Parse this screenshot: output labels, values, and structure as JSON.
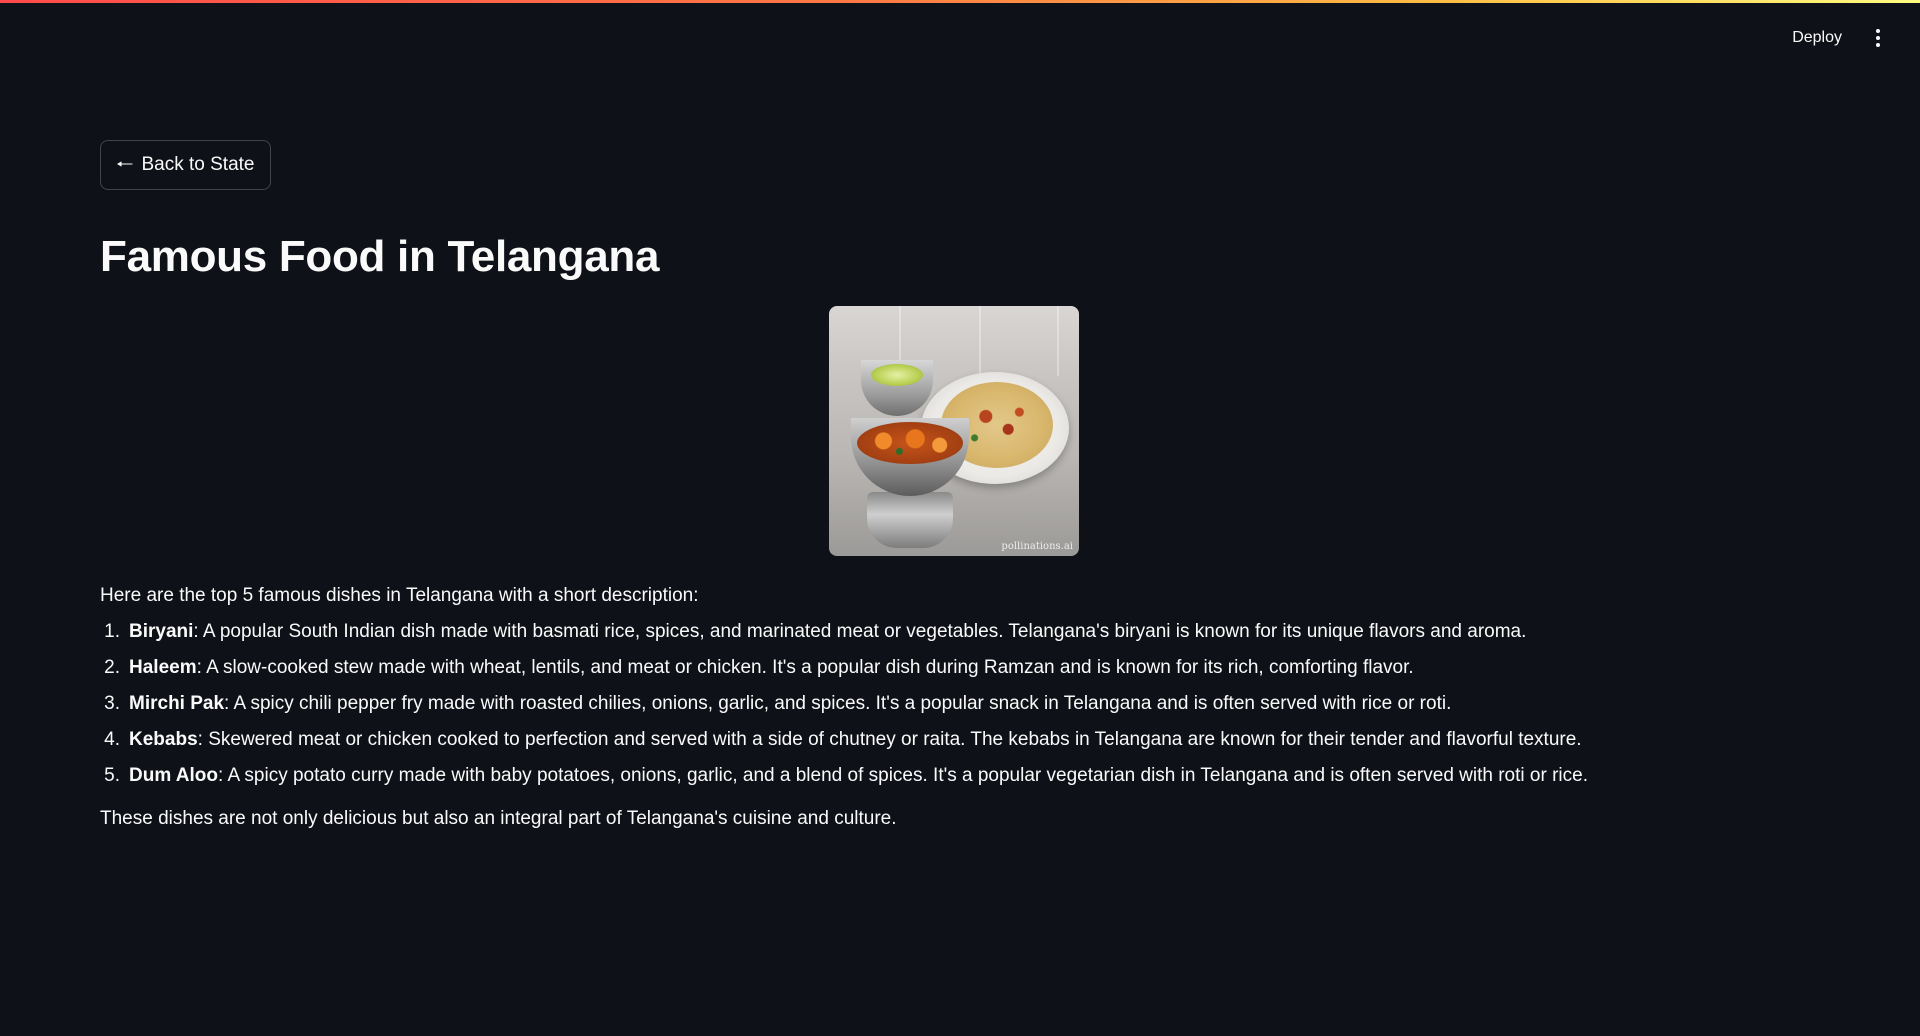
{
  "header": {
    "deploy_label": "Deploy"
  },
  "back_button": {
    "arrow": "🠐",
    "label": "Back to State"
  },
  "page_title": "Famous Food in Telangana",
  "image": {
    "watermark": "pollinations.ai"
  },
  "content": {
    "intro": "Here are the top 5 famous dishes in Telangana with a short description:",
    "dishes": [
      {
        "num": "1.",
        "name": "Biryani",
        "description": ": A popular South Indian dish made with basmati rice, spices, and marinated meat or vegetables. Telangana's biryani is known for its unique flavors and aroma."
      },
      {
        "num": "2.",
        "name": "Haleem",
        "description": ": A slow-cooked stew made with wheat, lentils, and meat or chicken. It's a popular dish during Ramzan and is known for its rich, comforting flavor."
      },
      {
        "num": "3.",
        "name": "Mirchi Pak",
        "description": ": A spicy chili pepper fry made with roasted chilies, onions, garlic, and spices. It's a popular snack in Telangana and is often served with rice or roti."
      },
      {
        "num": "4.",
        "name": "Kebabs",
        "description": ": Skewered meat or chicken cooked to perfection and served with a side of chutney or raita. The kebabs in Telangana are known for their tender and flavorful texture."
      },
      {
        "num": "5.",
        "name": "Dum Aloo",
        "description": ": A spicy potato curry made with baby potatoes, onions, garlic, and a blend of spices. It's a popular vegetarian dish in Telangana and is often served with roti or rice."
      }
    ],
    "outro": "These dishes are not only delicious but also an integral part of Telangana's cuisine and culture."
  }
}
